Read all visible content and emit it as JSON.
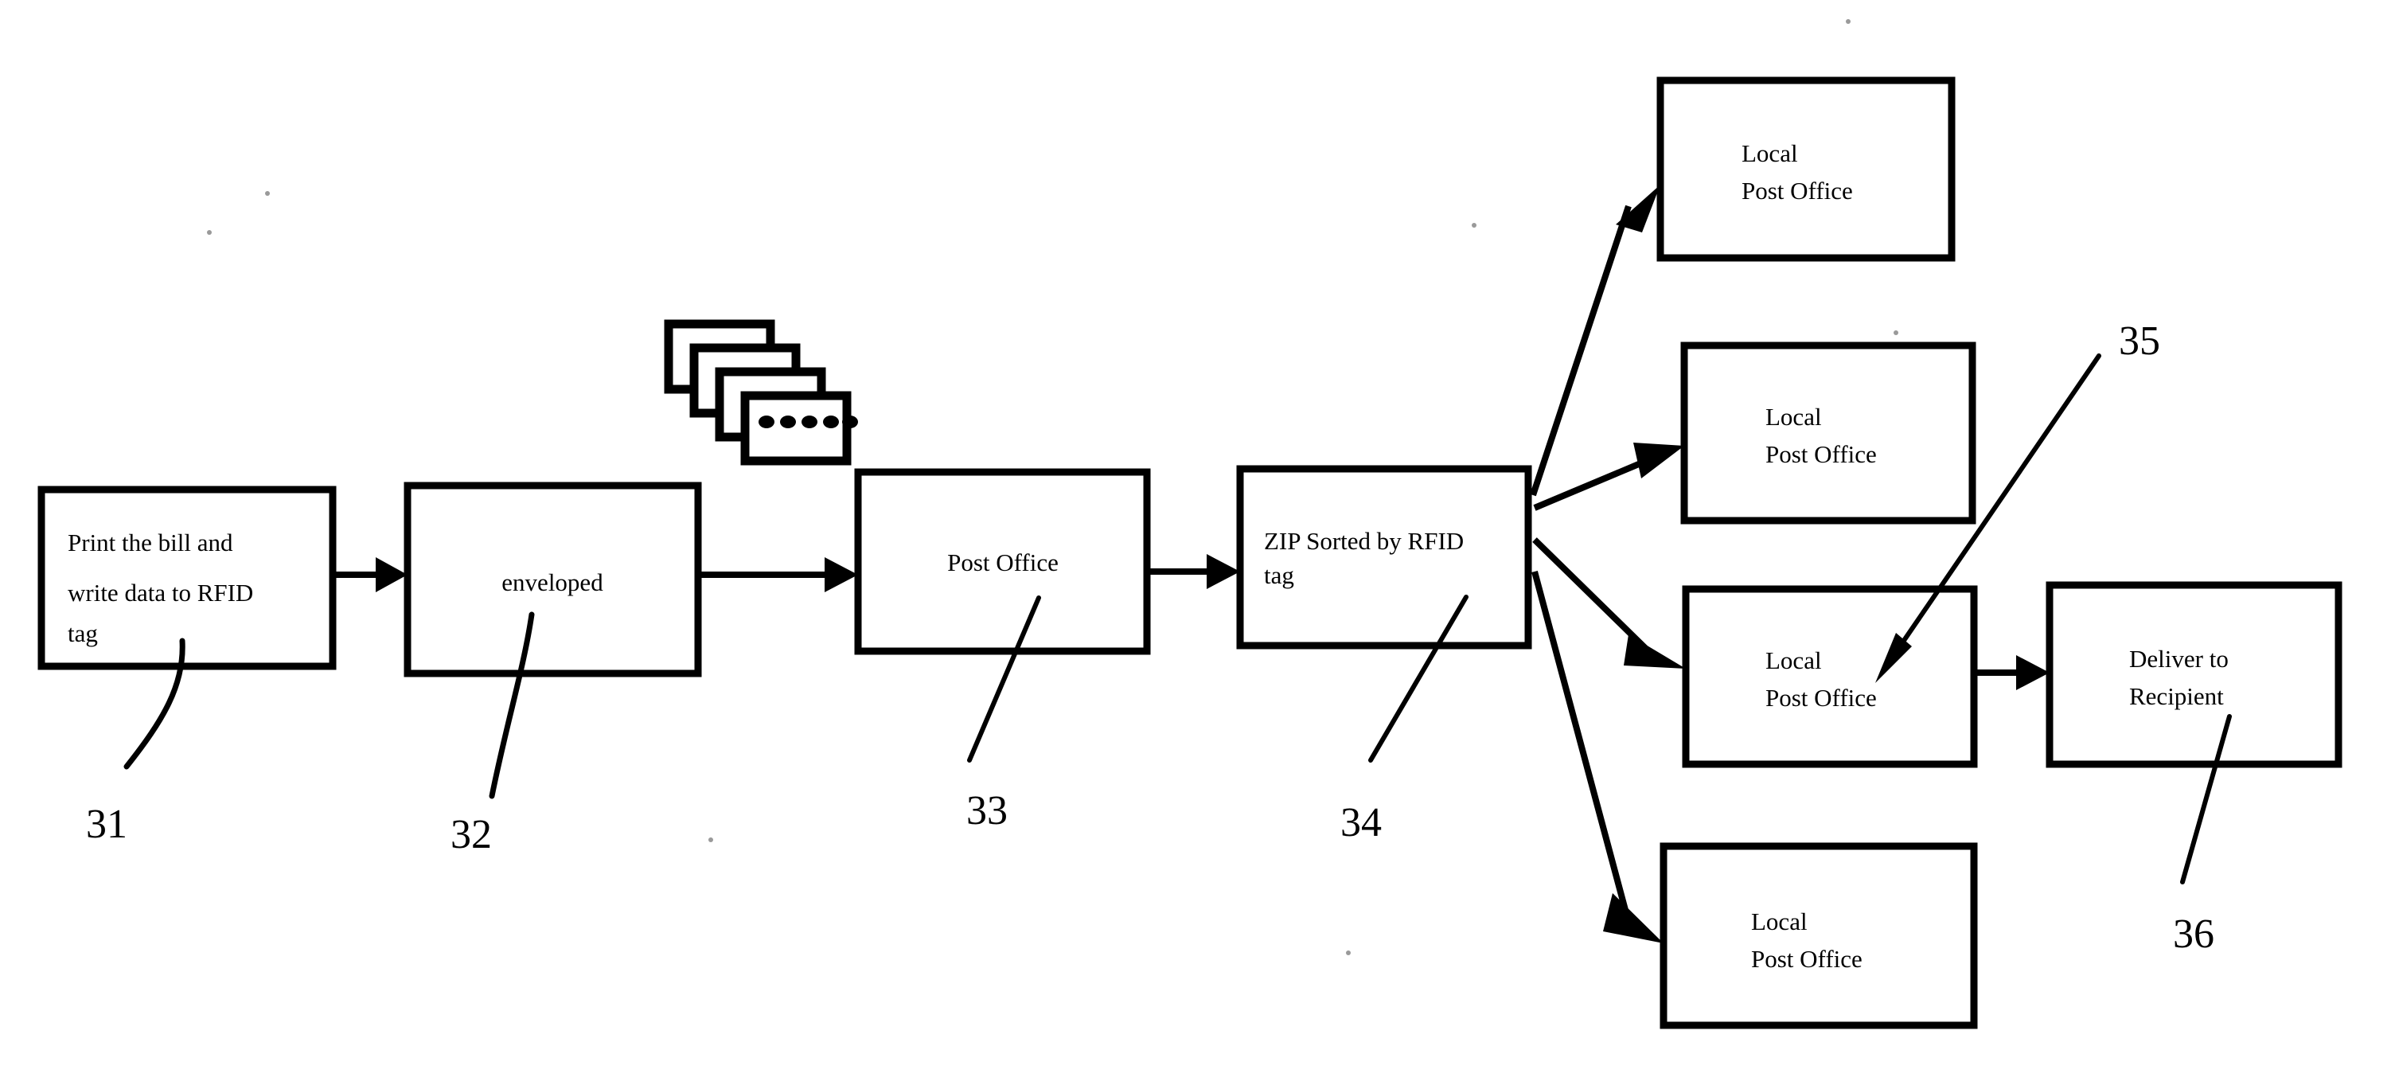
{
  "figure": {
    "type": "patent-flow-diagram",
    "background_color": "#ffffff",
    "line_color": "#000000"
  },
  "nodes": {
    "print_bill": {
      "ref": "31",
      "lines": [
        "Print the bill and",
        "write data to RFID",
        "tag"
      ],
      "align": "left"
    },
    "enveloped": {
      "ref": "32",
      "lines": [
        "enveloped"
      ],
      "align": "center"
    },
    "post_office": {
      "ref": "33",
      "lines": [
        "Post Office"
      ],
      "align": "center"
    },
    "zip_sorted": {
      "ref": "34",
      "lines": [
        "ZIP Sorted  by RFID",
        "tag"
      ],
      "align": "left"
    },
    "local_post_office_1": {
      "lines": [
        "Local",
        "Post Office"
      ],
      "align": "left"
    },
    "local_post_office_2": {
      "lines": [
        "Local",
        "Post Office"
      ],
      "align": "left"
    },
    "local_post_office_3": {
      "ref": "35",
      "lines": [
        "Local",
        "Post Office"
      ],
      "align": "left"
    },
    "local_post_office_4": {
      "lines": [
        "Local",
        "Post Office"
      ],
      "align": "left"
    },
    "deliver_to_recipient": {
      "ref": "36",
      "lines": [
        "Deliver to",
        "Recipient"
      ],
      "align": "left"
    }
  },
  "reference_numerals": {
    "n31": "31",
    "n32": "32",
    "n33": "33",
    "n34": "34",
    "n35": "35",
    "n36": "36"
  },
  "mail_stack_icon": {
    "name": "stacked-mail-icon",
    "card_count": 4,
    "dot_count": 5
  }
}
